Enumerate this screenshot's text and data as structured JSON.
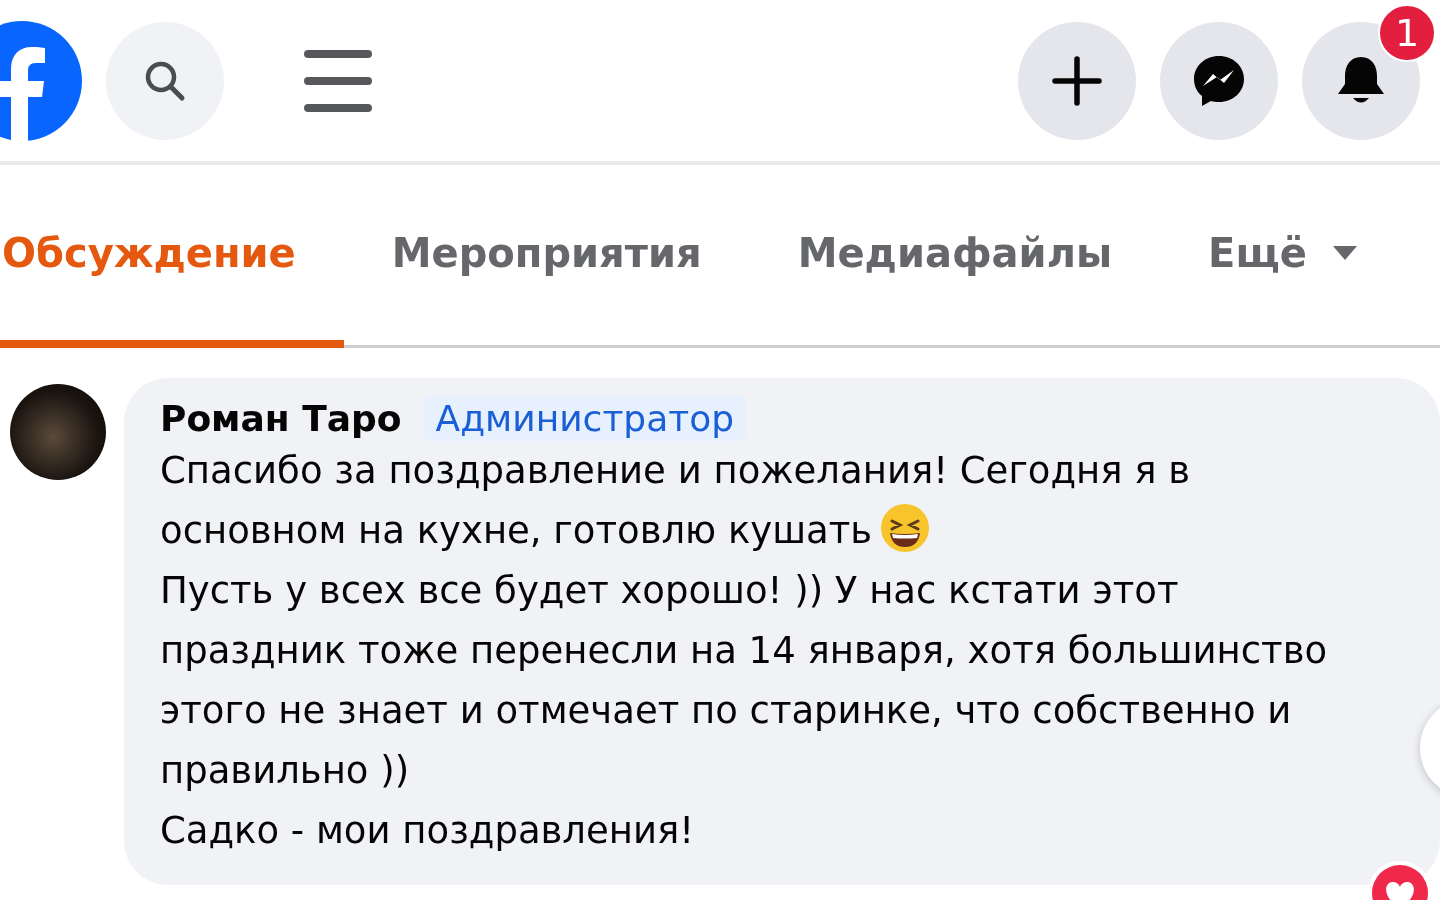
{
  "header": {
    "notification_badge": "1"
  },
  "tabs": [
    {
      "label": "Обсуждение",
      "selected": true
    },
    {
      "label": "Мероприятия",
      "selected": false
    },
    {
      "label": "Медиафайлы",
      "selected": false
    },
    {
      "label": "Ещё",
      "selected": false,
      "kind": "dropdown"
    }
  ],
  "comment": {
    "author": "Роман Таро",
    "role": "Администратор",
    "paragraphs": [
      {
        "text": "Спасибо за поздравление и пожелания! Сегодня я в основном на кухне, готовлю кушать",
        "kind": "laughing_emoji"
      },
      {
        "text": "Пусть у всех все будет хорошо! )) У нас кстати этот праздник тоже перенесли на 14 января, хотя большинство этого не знает и отмечает по старинке, что собственно и правильно ))"
      },
      {
        "text": "Садко - мои поздравления!"
      }
    ],
    "reaction": {
      "kind": "heart"
    }
  }
}
